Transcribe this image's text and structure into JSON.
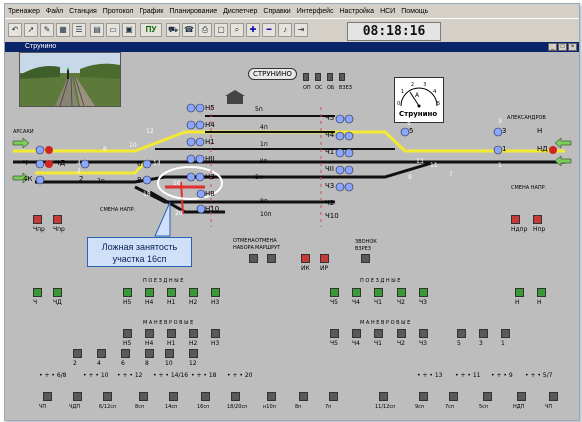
{
  "menu": [
    "Тренажер",
    "Файл",
    "Станция",
    "Протокол",
    "График",
    "Планирование",
    "Диспетчер",
    "Справки",
    "Интерфейс",
    "Настройка",
    "НСИ",
    "Помощь"
  ],
  "toolbar": {
    "clock": "08:18:16",
    "pu_label": "ПУ"
  },
  "window": {
    "title": "Струнино"
  },
  "station": {
    "name": "СТРУНИНО",
    "ammeter_label": "Струнино",
    "ammeter_unit": "A",
    "ammeter_ticks": [
      "0",
      "1",
      "2",
      "3",
      "4",
      "5"
    ]
  },
  "directions": {
    "left": "АРСАКИ",
    "right": "АЛЕКСАНДРОВ"
  },
  "small_buttons": [
    "ОП",
    "ОС",
    "ОБ",
    "В3ЕЗ"
  ],
  "signals_left": [
    "Н5",
    "Н4",
    "Н1",
    "НII",
    "Н3",
    "Н8",
    "Н10",
    "Ч",
    "ЧД",
    "2",
    "4К",
    "6",
    "8"
  ],
  "signals_right": [
    "Ч5",
    "Ч4",
    "Ч1",
    "ЧII",
    "Ч3",
    "Ч2",
    "Ч10",
    "5",
    "3",
    "1",
    "Н",
    "НД"
  ],
  "tracks": [
    "5п",
    "4п",
    "1п",
    "IIп",
    "3п",
    "8п",
    "10п",
    "7п"
  ],
  "switch_numbers": [
    "12",
    "10",
    "6",
    "4",
    "2",
    "14",
    "16",
    "18",
    "20",
    "13",
    "11",
    "9",
    "7",
    "5",
    "3",
    "1"
  ],
  "callout": {
    "line1": "Ложная занятость",
    "line2": "участка 16сп"
  },
  "blocks": {
    "left_a": [
      "Чпр",
      "Чпр"
    ],
    "smena_left": "СМЕНА НАПР.",
    "otmena": [
      "ОТМЕНА",
      "ОТМЕНА",
      "НАБОРА",
      "МАРШРУТ"
    ],
    "ik_ir": [
      "ИК",
      "ИР"
    ],
    "zvonok": [
      "ЗВОНОК",
      "В3РЕЗ"
    ],
    "smena_right": "СМЕНА НАПР.",
    "right_a": [
      "Ндпр",
      "Нпр"
    ]
  },
  "poezdnye_label": "П О Е З Д Н Ы Е",
  "manevrovye_label": "М А Н Е В Р О В Ы Е",
  "row1_left": [
    "Ч",
    "ЧД",
    "Н5",
    "Н4",
    "Н1",
    "Н2",
    "Н3"
  ],
  "row1_right": [
    "Ч5",
    "Ч4",
    "Ч1",
    "Ч2",
    "Ч3",
    "Н",
    "Н"
  ],
  "row2_left": [
    "Н5",
    "Н4",
    "Н1",
    "Н2",
    "Н3"
  ],
  "row2_right": [
    "Ч5",
    "Ч4",
    "Ч1",
    "Ч2",
    "Ч3",
    "5",
    "3",
    "1"
  ],
  "row3_left": [
    "2",
    "4",
    "6",
    "8",
    "10",
    "12"
  ],
  "row4_left": [
    "6/8",
    "10",
    "12",
    "14/16",
    "18",
    "20"
  ],
  "row4_right": [
    "13",
    "11",
    "9",
    "5/7"
  ],
  "row5": [
    "ЧП",
    "ЧДП",
    "6/12сп",
    "8сп",
    "14сп",
    "16сп",
    "18/20сп",
    "н10п",
    "8п",
    "7п",
    "11/12сп",
    "9сп",
    "7сп",
    "5сп",
    "НДП",
    "ЧП"
  ]
}
